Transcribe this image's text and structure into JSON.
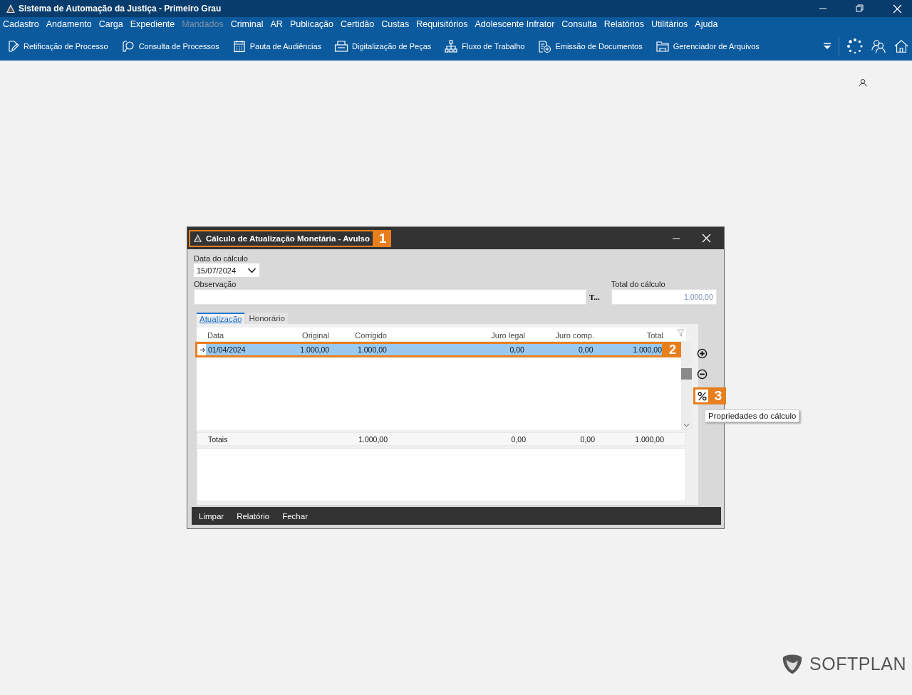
{
  "window": {
    "title": "Sistema de Automação da Justiça - Primeiro Grau"
  },
  "menu": [
    {
      "label": "Cadastro",
      "disabled": false
    },
    {
      "label": "Andamento",
      "disabled": false
    },
    {
      "label": "Carga",
      "disabled": false
    },
    {
      "label": "Expediente",
      "disabled": false
    },
    {
      "label": "Mandados",
      "disabled": true
    },
    {
      "label": "Criminal",
      "disabled": false
    },
    {
      "label": "AR",
      "disabled": false
    },
    {
      "label": "Publicação",
      "disabled": false
    },
    {
      "label": "Certidão",
      "disabled": false
    },
    {
      "label": "Custas",
      "disabled": false
    },
    {
      "label": "Requisitórios",
      "disabled": false
    },
    {
      "label": "Adolescente Infrator",
      "disabled": false
    },
    {
      "label": "Consulta",
      "disabled": false
    },
    {
      "label": "Relatórios",
      "disabled": false
    },
    {
      "label": "Utilitários",
      "disabled": false
    },
    {
      "label": "Ajuda",
      "disabled": false
    }
  ],
  "toolbar": [
    {
      "label": "Retificação de Processo",
      "kind": "edit"
    },
    {
      "label": "Consulta de Processos",
      "kind": "search"
    },
    {
      "label": "Pauta de Audiências",
      "kind": "calendar"
    },
    {
      "label": "Digitalização de Peças",
      "kind": "scanner"
    },
    {
      "label": "Fluxo de Trabalho",
      "kind": "flow"
    },
    {
      "label": "Emissão de Documentos",
      "kind": "document"
    },
    {
      "label": "Gerenciador de Arquivos",
      "kind": "folder"
    }
  ],
  "dialog": {
    "title": "Cálculo de Atualização Monetária - Avulso",
    "title_callout": "1",
    "date_label": "Data do cálculo",
    "date_value": "15/07/2024",
    "obs_label": "Observação",
    "obs_button": "T...",
    "total_label": "Total do cálculo",
    "total_value": "1.000,00",
    "tabs": [
      {
        "label": "Atualização",
        "selected": true
      },
      {
        "label": "Honorário",
        "selected": false
      }
    ],
    "grid": {
      "columns": [
        "Data",
        "Original",
        "Corrigido",
        "Juro legal",
        "Juro comp.",
        "Total"
      ],
      "rows": [
        {
          "cells": [
            "01/04/2024",
            "1.000,00",
            "1.000,00",
            "0,00",
            "0,00",
            "1.000,00"
          ],
          "selected": true,
          "callout": "2"
        }
      ],
      "totals_label": "Totais",
      "totals": [
        "1.000,00",
        "0,00",
        "0,00",
        "1.000,00"
      ]
    },
    "side_buttons": [
      {
        "kind": "add"
      },
      {
        "kind": "remove"
      },
      {
        "kind": "percent",
        "callout": "3",
        "tooltip": "Propriedades do cálculo"
      }
    ],
    "footer_buttons": [
      "Limpar",
      "Relatório",
      "Fechar"
    ]
  },
  "logo": {
    "text": "SOFTPLAN"
  }
}
